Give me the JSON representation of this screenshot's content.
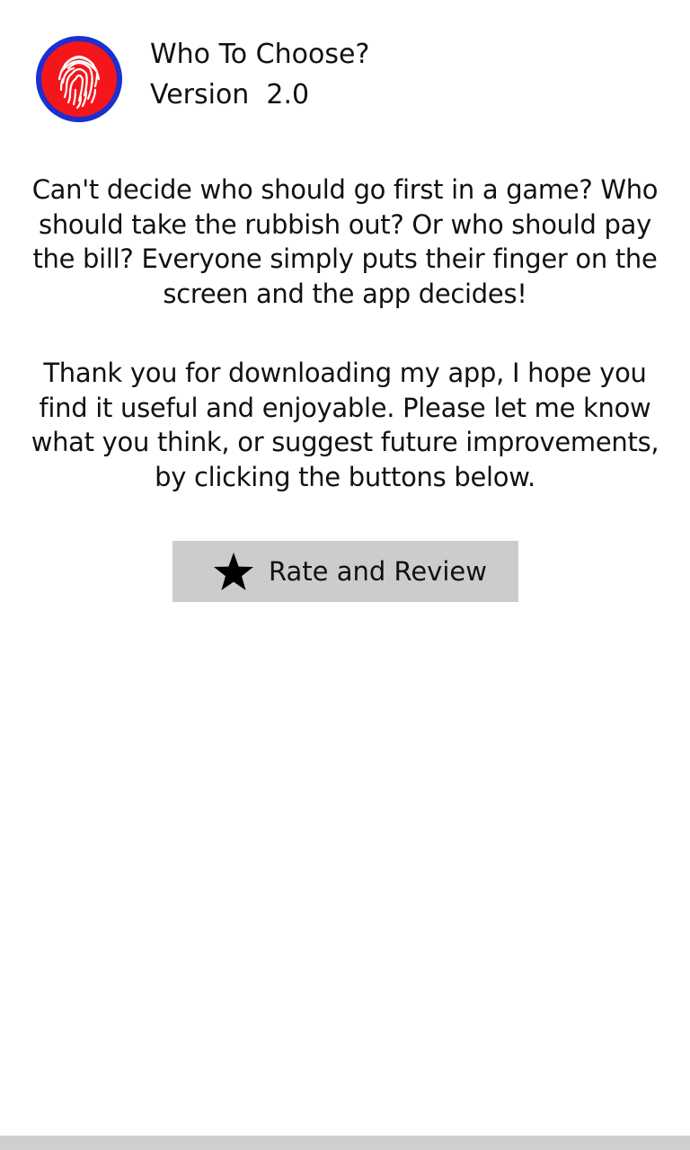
{
  "app": {
    "title": "Who To Choose?",
    "version_label": "Version  2.0",
    "icon": "fingerprint-icon",
    "icon_colors": {
      "ring": "#1c2fd0",
      "fill": "#f4161b",
      "print": "#ffffff"
    }
  },
  "content": {
    "paragraph1": "Can't decide who should go first in a game? Who should take the rubbish out? Or who should pay the bill? Everyone simply puts their finger on the screen and the app decides!",
    "paragraph2": "Thank you for downloading my app, I hope you find it useful and enjoyable. Please let me know what you think, or suggest future improvements, by clicking the buttons below."
  },
  "actions": {
    "rate_button": {
      "label": "Rate and Review",
      "icon": "star-icon",
      "background": "#cccccc"
    }
  },
  "colors": {
    "background": "#ffffff",
    "text": "#111111",
    "bottom_bar": "#cfcfcf"
  }
}
